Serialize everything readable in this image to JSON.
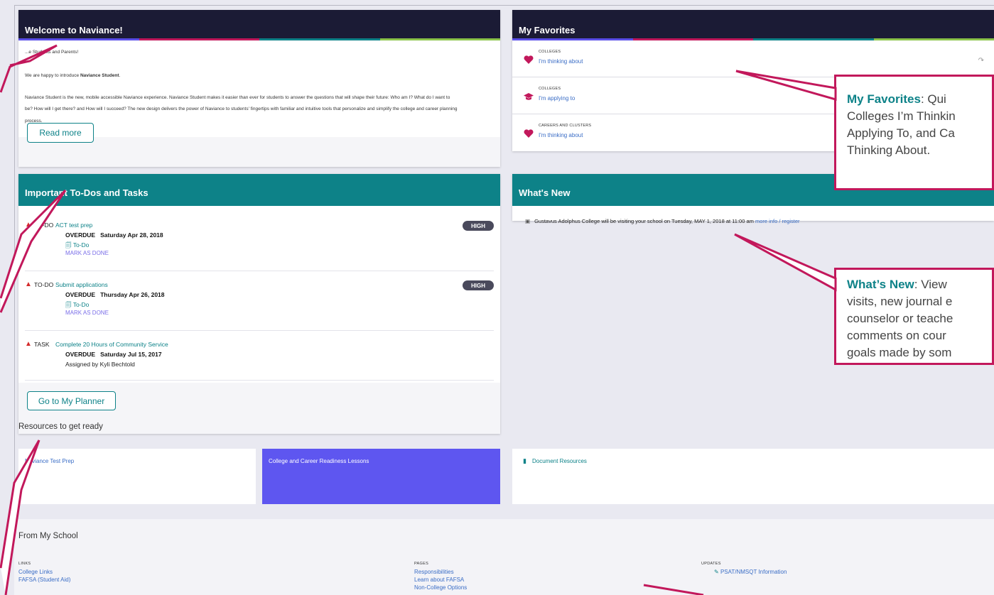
{
  "welcome": {
    "title": "Welcome to Naviance!",
    "greeting": "...e Students and Parents!",
    "intro_prefix": "We are happy to introduce ",
    "intro_brand": "Naviance Student",
    "intro_suffix": ".",
    "body_line1": "Naviance Student is the new, mobile accessible Naviance experience. Naviance Student makes it easier than ever for students to answer the questions that will shape their future: Who am I? What do I want to",
    "body_line2": "be? How will I get there? and How will I succeed? The new design delivers the power of Naviance to students' fingertips with familiar and intuitive tools that personalize and simplify the college and career planning",
    "body_line3": "process.",
    "read_more": "Read more"
  },
  "favorites": {
    "title": "My Favorites",
    "items": [
      {
        "category": "COLLEGES",
        "link": "I'm thinking about",
        "icon": "heart-icon"
      },
      {
        "category": "COLLEGES",
        "link": "I'm applying to",
        "icon": "graduation-cap-icon"
      },
      {
        "category": "CAREERS AND CLUSTERS",
        "link": "I'm thinking about",
        "icon": "heart-icon"
      }
    ]
  },
  "todos": {
    "title": "Important To-Dos and Tasks",
    "items": [
      {
        "kind": "TO-DO",
        "title": "ACT test prep",
        "overdue": "OVERDUE   Saturday Apr 28, 2018",
        "sub": "To-Do",
        "mark": "MARK AS DONE",
        "badge": "HIGH"
      },
      {
        "kind": "TO-DO",
        "title": "Submit applications",
        "overdue": "OVERDUE   Thursday Apr 26, 2018",
        "sub": "To-Do",
        "mark": "MARK AS DONE",
        "badge": "HIGH"
      },
      {
        "kind": "TASK",
        "title": "Complete 20 Hours of Community Service",
        "overdue": "OVERDUE   Saturday Jul 15, 2017",
        "assigned": "Assigned by Kyli Bechtold"
      }
    ],
    "planner_button": "Go to My Planner"
  },
  "whats_new": {
    "title": "What's New",
    "item_text": "Gustavus Adolphus College will be visiting your school on Tuesday, MAY 1, 2018 at 11:00 am",
    "more_info": "more info",
    "separator": " / ",
    "register": "register"
  },
  "resources": {
    "heading": "Resources to get ready",
    "tiles": [
      "Naviance Test Prep",
      "College and Career Readiness Lessons",
      "Document Resources"
    ]
  },
  "from_school": {
    "heading": "From My School",
    "links_head": "LINKS",
    "links": [
      "College Links",
      "FAFSA (Student Aid)"
    ],
    "pages_head": "PAGES",
    "pages": [
      "Responsibilities",
      "Learn about FAFSA",
      "Non-College Options"
    ],
    "updates_head": "UPDATES",
    "updates": [
      "PSAT/NMSQT Information"
    ]
  },
  "callouts": {
    "favorites_kw": "My Favorites",
    "favorites_l1": ": Qui",
    "favorites_l2": "Colleges I’m Thinkin",
    "favorites_l3": "Applying To, and Ca",
    "favorites_l4": "Thinking About.",
    "new_kw": "What’s New",
    "new_l1": ":  View",
    "new_l2": "visits, new journal e",
    "new_l3": "counselor or teache",
    "new_l4": "comments on cour",
    "new_l5": "goals made by som"
  },
  "colors": {
    "teal": "#0d8288",
    "navy": "#1b1b35",
    "callout_border": "#c2185b",
    "lesson_tile": "#5e56f0",
    "stripe": [
      "#5a4ee8",
      "#c2185b",
      "#0d8288",
      "#8bc34a"
    ]
  }
}
